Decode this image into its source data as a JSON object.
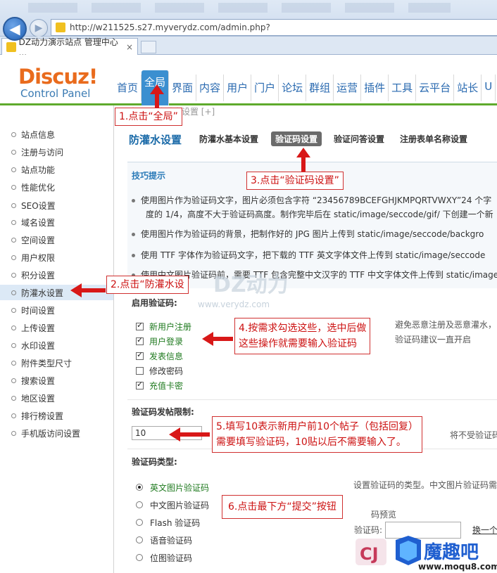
{
  "browser": {
    "back_icon": "back-arrow-icon",
    "forward_icon": "forward-arrow-icon",
    "url": "http://w211525.s27.myverydz.com/admin.php?",
    "tab_title": "DZ动力演示站点 管理中心 ...",
    "tab_close": "×"
  },
  "logo": {
    "main": "Discuz!",
    "sub": "Control Panel"
  },
  "top_nav": [
    "首页",
    "全局",
    "界面",
    "内容",
    "用户",
    "门户",
    "论坛",
    "群组",
    "运营",
    "插件",
    "工具",
    "云平台",
    "站长",
    "U"
  ],
  "top_nav_active": "全局",
  "sidebar": [
    "站点信息",
    "注册与访问",
    "站点功能",
    "性能优化",
    "SEO设置",
    "域名设置",
    "空间设置",
    "用户权限",
    "积分设置",
    "防灌水设置",
    "时间设置",
    "上传设置",
    "水印设置",
    "附件类型尺寸",
    "搜索设置",
    "地区设置",
    "排行榜设置",
    "手机版访问设置"
  ],
  "sidebar_active": "防灌水设置",
  "main": {
    "breadcrumb": "全局 » 防灌水设置 [+]",
    "page_title": "防灌水设置",
    "subtabs": [
      "防灌水基本设置",
      "验证码设置",
      "验证问答设置",
      "注册表单名称设置"
    ],
    "subtab_active": "验证码设置",
    "tips_title": "技巧提示",
    "tips": [
      "使用图片作为验证码文字，图片必须包含字符 “23456789BCEFGHJKMPQRTVWXY”24 个字",
      "度的 1/4，高度不大于验证码高度。制作完毕后在 static/image/seccode/gif/ 下创建一个新",
      "使用图片作为验证码的背景，把制作好的 JPG 图片上传到 static/image/seccode/backgro",
      "使用 TTF 字体作为验证码文字，把下载的 TTF 英文字体文件上传到 static/image/seccode",
      "使用中文图片验证码前，需要 TTF 包含完整中文汉字的 TTF 中文字体文件上传到 static/image/"
    ],
    "watermark": "DZ动力",
    "watermark_url": "www.verydz.com",
    "enable_label": "启用验证码:",
    "checkboxes": [
      {
        "label": "新用户注册",
        "checked": true
      },
      {
        "label": "用户登录",
        "checked": true
      },
      {
        "label": "发表信息",
        "checked": true
      },
      {
        "label": "修改密码",
        "checked": false
      },
      {
        "label": "充值卡密",
        "checked": true
      }
    ],
    "enable_note_1": "避免恶意注册及恶意灌水，",
    "enable_note_2": "验证码建议一直开启",
    "limit_label": "验证码发帖限制:",
    "limit_value": "10",
    "limit_note": "将不受验证码",
    "type_label": "验证码类型:",
    "types": [
      {
        "label": "英文图片验证码",
        "selected": true
      },
      {
        "label": "中文图片验证码",
        "selected": false
      },
      {
        "label": "Flash 验证码",
        "selected": false
      },
      {
        "label": "语音验证码",
        "selected": false
      },
      {
        "label": "位图验证码",
        "selected": false
      }
    ],
    "type_note": "设置验证码的类型。中文图片验证码需",
    "preview_title": "码预览",
    "preview_label": "验证码:",
    "preview_link": "换一个"
  },
  "annotations": [
    "1.点击“全局”",
    "2.点击“防灌水设",
    "3.点击“验证码设置”",
    "4.按需求勾选这些，选中后做",
    "这些操作就需要输入验证码",
    "5.填写10表示新用户前10个帖子（包括回复）",
    "需要填写验证码，10贴以后不需要输入了。",
    "6.点击最下方“提交”按钮"
  ],
  "arrow_color": "#d81818",
  "brand_logo": {
    "text": "魔趣吧",
    "url": "www.moqu8.com",
    "corner": "CJ"
  }
}
